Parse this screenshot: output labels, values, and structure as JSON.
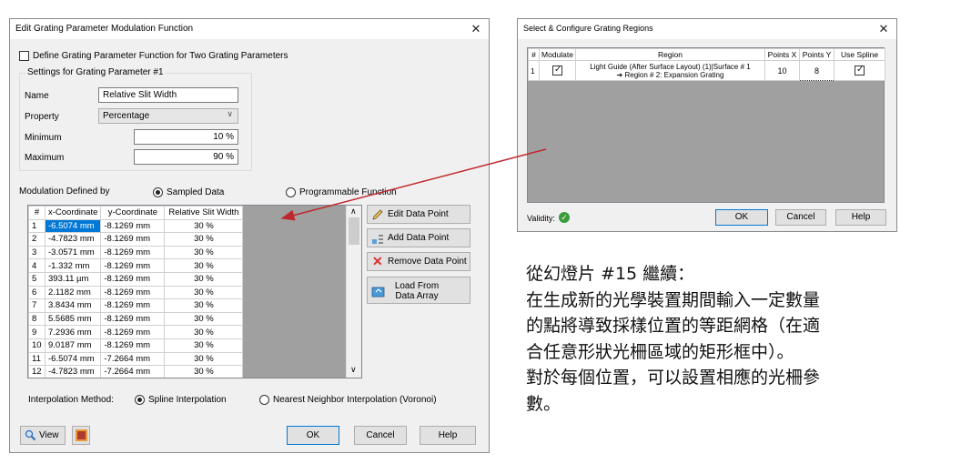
{
  "main_dialog": {
    "title": "Edit Grating Parameter Modulation Function",
    "two_params_label": "Define Grating Parameter Function for Two Grating Parameters",
    "two_params_checked": false,
    "settings_group_title": "Settings for Grating Parameter #1",
    "name_label": "Name",
    "name_value": "Relative Slit Width",
    "property_label": "Property",
    "property_value": "Percentage",
    "minimum_label": "Minimum",
    "minimum_value": "10 %",
    "maximum_label": "Maximum",
    "maximum_value": "90 %",
    "modulation_label": "Modulation Defined by",
    "mod_option_sampled": "Sampled Data",
    "mod_option_programmable": "Programmable Function",
    "mod_selected": "Sampled Data",
    "table": {
      "columns": [
        "#",
        "x-Coordinate",
        "y-Coordinate",
        "Relative Slit Width"
      ],
      "selected_row": 1,
      "rows": [
        [
          "1",
          "-6.5074 mm",
          "-8.1269 mm",
          "30 %"
        ],
        [
          "2",
          "-4.7823 mm",
          "-8.1269 mm",
          "30 %"
        ],
        [
          "3",
          "-3.0571 mm",
          "-8.1269 mm",
          "30 %"
        ],
        [
          "4",
          "-1.332 mm",
          "-8.1269 mm",
          "30 %"
        ],
        [
          "5",
          "393.11 µm",
          "-8.1269 mm",
          "30 %"
        ],
        [
          "6",
          "2.1182 mm",
          "-8.1269 mm",
          "30 %"
        ],
        [
          "7",
          "3.8434 mm",
          "-8.1269 mm",
          "30 %"
        ],
        [
          "8",
          "5.5685 mm",
          "-8.1269 mm",
          "30 %"
        ],
        [
          "9",
          "7.2936 mm",
          "-8.1269 mm",
          "30 %"
        ],
        [
          "10",
          "9.0187 mm",
          "-8.1269 mm",
          "30 %"
        ],
        [
          "11",
          "-6.5074 mm",
          "-7.2664 mm",
          "30 %"
        ],
        [
          "12",
          "-4.7823 mm",
          "-7.2664 mm",
          "30 %"
        ]
      ]
    },
    "buttons": {
      "edit_point": "Edit Data Point",
      "add_point": "Add Data Point",
      "remove_point": "Remove Data Point",
      "load_array": "Load From Data Array",
      "view": "View",
      "ok": "OK",
      "cancel": "Cancel",
      "help": "Help"
    },
    "interp_label": "Interpolation Method:",
    "interp_spline": "Spline Interpolation",
    "interp_nearest": "Nearest Neighbor Interpolation (Voronoi)",
    "interp_selected": "Spline Interpolation"
  },
  "region_dialog": {
    "title": "Select & Configure Grating Regions",
    "columns": [
      "#",
      "Modulate",
      "Region",
      "Points X",
      "Points Y",
      "Use Spline"
    ],
    "row": {
      "index": "1",
      "modulate": true,
      "region_line1": "Light Guide (After Surface Layout) (1)|Surface # 1",
      "region_line2": "➔ Region # 2: Expansion Grating",
      "points_x": "10",
      "points_y": "8",
      "use_spline": true
    },
    "validity_label": "Validity:",
    "ok": "OK",
    "cancel": "Cancel",
    "help": "Help"
  },
  "annotation": {
    "lines": [
      "從幻燈片 #15 繼續：",
      "在生成新的光學裝置期間輸入一定數量",
      "的點將導致採樣位置的等距網格（在適",
      "合任意形狀光柵區域的矩形框中）。",
      "對於每個位置，可以設置相應的光柵參",
      "數。"
    ]
  },
  "colors": {
    "selection": "#0078d7",
    "arrow": "#c0272d",
    "remove_icon": "#d9302c",
    "validity_ok": "#3a9b3a"
  },
  "icons": {
    "edit": "pencil-icon",
    "add": "add-point-icon",
    "remove": "red-x-icon",
    "load": "load-array-icon",
    "view": "magnifier-icon",
    "validity": "green-check-icon"
  }
}
